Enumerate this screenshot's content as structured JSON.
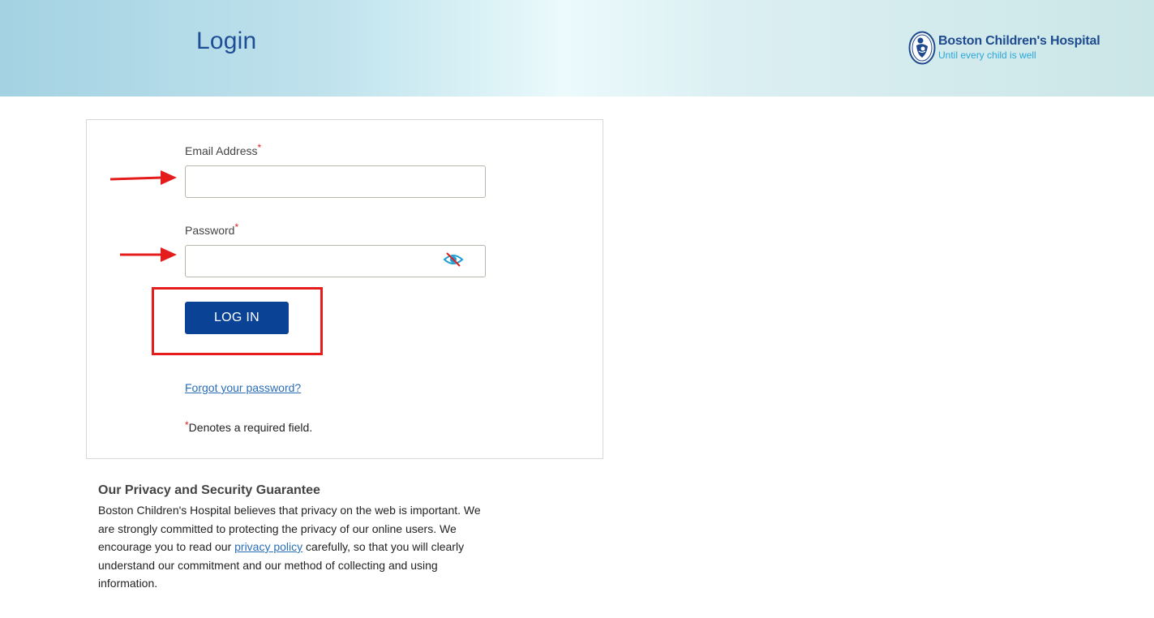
{
  "header": {
    "title": "Login",
    "logo": {
      "name": "Boston Children's Hospital",
      "tagline": "Until every child is well"
    }
  },
  "form": {
    "email": {
      "label": "Email Address",
      "required_marker": "*",
      "value": "",
      "placeholder": ""
    },
    "password": {
      "label": "Password",
      "required_marker": "*",
      "value": "",
      "placeholder": "",
      "toggle_icon": "eye-slash-icon"
    },
    "login_button": "LOG IN",
    "forgot_password": "Forgot your password?",
    "required_note": {
      "marker": "*",
      "text": "Denotes a required field."
    }
  },
  "privacy": {
    "heading": "Our Privacy and Security Guarantee",
    "body_before_link": "Boston Children's Hospital believes that privacy on the web is important. We are strongly committed to protecting the privacy of our online users. We encourage you to read our ",
    "link_text": "privacy policy",
    "body_after_link": " carefully, so that you will clearly understand our commitment and our method of collecting and using information."
  },
  "annotations": {
    "arrow_color": "#e41c1c",
    "highlight_color": "#e41c1c"
  },
  "colors": {
    "primary_button": "#0a4396",
    "title": "#1f4e96",
    "link": "#2a6eb8"
  }
}
